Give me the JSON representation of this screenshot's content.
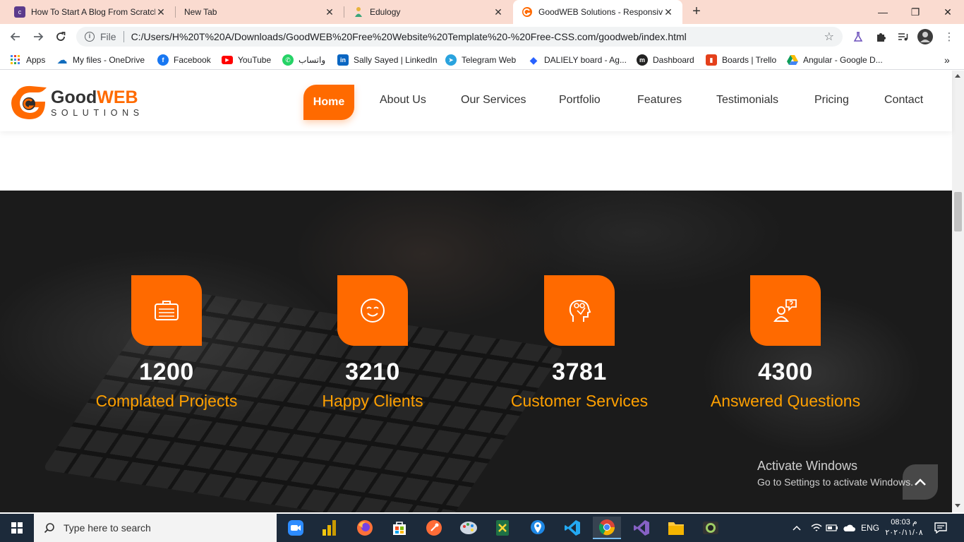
{
  "browser": {
    "tabs": [
      {
        "title": "How To Start A Blog From Scratch",
        "favicon_color": "#5b3b8c",
        "favicon_glyph": "colorlib"
      },
      {
        "title": "New Tab",
        "favicon_color": "",
        "favicon_glyph": ""
      },
      {
        "title": "Edulogy",
        "favicon_color": "#e8b33c",
        "favicon_glyph": "edulogy-icon"
      },
      {
        "title": "GoodWEB Solutions - Responsive",
        "favicon_color": "#ff6a00",
        "favicon_glyph": "goodweb-icon"
      }
    ],
    "new_tab": "+",
    "window_controls": {
      "minimize": "—",
      "restore": "❐",
      "close": "✕"
    },
    "address": {
      "scheme_label": "File",
      "url": "C:/Users/H%20T%20A/Downloads/GoodWEB%20Free%20Website%20Template%20-%20Free-CSS.com/goodweb/index.html"
    },
    "bookmarks": [
      {
        "label": "Apps",
        "color": "#ea4335",
        "glyph": "⠿"
      },
      {
        "label": "My files - OneDrive",
        "color": "#0f6cbd",
        "glyph": "☁"
      },
      {
        "label": "Facebook",
        "color": "#1877f2",
        "glyph": "f"
      },
      {
        "label": "YouTube",
        "color": "#ff0000",
        "glyph": "▶"
      },
      {
        "label": "واتساب",
        "color": "#25d366",
        "glyph": "✆"
      },
      {
        "label": "Sally Sayed | LinkedIn",
        "color": "#0a66c2",
        "glyph": "in"
      },
      {
        "label": "Telegram Web",
        "color": "#2aa3de",
        "glyph": "➤"
      },
      {
        "label": "DALIELY board - Ag...",
        "color": "#2962ff",
        "glyph": "◆"
      },
      {
        "label": "Dashboard",
        "color": "#222222",
        "glyph": "m"
      },
      {
        "label": "Boards | Trello",
        "color": "#e4401b",
        "glyph": "▮"
      },
      {
        "label": "Angular - Google D...",
        "color": "#0f9d58",
        "glyph": "▲"
      }
    ],
    "bookmarks_overflow": "»"
  },
  "site": {
    "logo": {
      "word1": "Good",
      "word2": "WEB",
      "tagline": "SOLUTIONS"
    },
    "menu": [
      "Home",
      "About Us",
      "Our Services",
      "Portfolio",
      "Features",
      "Testimonials",
      "Pricing",
      "Contact"
    ],
    "accent": "#ff6a00",
    "label_color": "#ffa000",
    "stats": [
      {
        "number": "1200",
        "label": "Complated Projects",
        "icon": "briefcase-icon"
      },
      {
        "number": "3210",
        "label": "Happy Clients",
        "icon": "smiley-icon"
      },
      {
        "number": "3781",
        "label": "Customer Services",
        "icon": "head-gears-icon"
      },
      {
        "number": "4300",
        "label": "Answered Questions",
        "icon": "user-question-icon"
      }
    ]
  },
  "watermark": {
    "line1": "Activate Windows",
    "line2": "Go to Settings to activate Windows."
  },
  "taskbar": {
    "search_placeholder": "Type here to search",
    "apps": [
      "zoom-icon",
      "power-bi-icon",
      "firefox-icon",
      "store-icon",
      "postman-icon",
      "paint-icon",
      "sheets-icon",
      "maps-icon",
      "vscode-icon",
      "chrome-icon",
      "visual-studio-icon",
      "file-explorer-icon",
      "camera-icon"
    ],
    "language": "ENG",
    "time": "08:03 م",
    "date": "٢٠٢٠/١١/٠٨"
  }
}
